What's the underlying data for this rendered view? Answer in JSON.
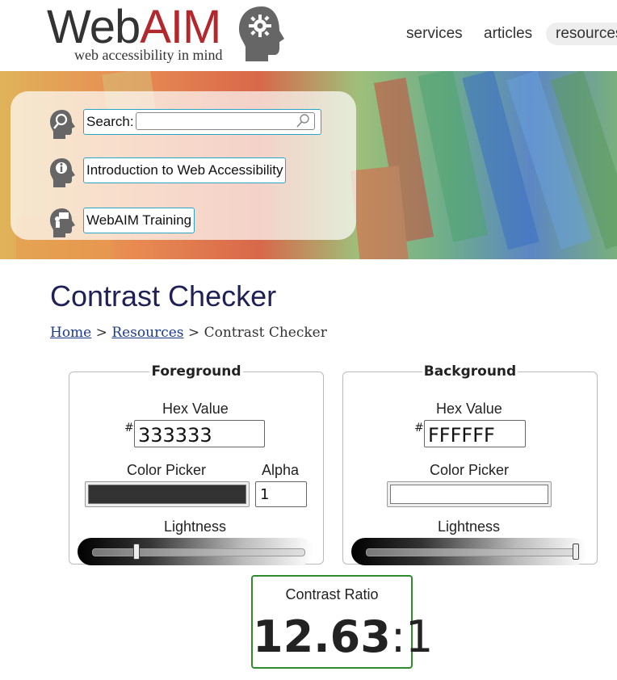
{
  "header": {
    "logo": {
      "word_web": "Web",
      "word_aim": "AIM",
      "tagline": "web accessibility in mind"
    },
    "nav": [
      {
        "label": "services"
      },
      {
        "label": "articles"
      },
      {
        "label": "resources"
      }
    ]
  },
  "quicklinks": {
    "search_label": "Search:",
    "search_value": "",
    "intro_link": "Introduction to Web Accessibility",
    "training_link": "WebAIM Training"
  },
  "page": {
    "title": "Contrast Checker",
    "breadcrumb": {
      "home": "Home",
      "resources": "Resources",
      "sep": ">",
      "current": "Contrast Checker"
    }
  },
  "foreground": {
    "legend": "Foreground",
    "hex_label": "Hex Value",
    "hash": "#",
    "hex_value": "333333",
    "picker_label": "Color Picker",
    "picker_color": "#333333",
    "alpha_label": "Alpha",
    "alpha_value": "1",
    "lightness_label": "Lightness",
    "lightness_fraction": 0.2
  },
  "background": {
    "legend": "Background",
    "hex_label": "Hex Value",
    "hash": "#",
    "hex_value": "FFFFFF",
    "picker_label": "Color Picker",
    "picker_color": "#FFFFFF",
    "lightness_label": "Lightness",
    "lightness_fraction": 1.0
  },
  "result": {
    "label": "Contrast Ratio",
    "ratio_value": "12.63",
    "ratio_sep": ":",
    "ratio_base": "1"
  },
  "colors": {
    "accent_border": "#2aa5c8",
    "pass_green": "#2e8b2e",
    "title": "#1f2055",
    "logo_red": "#b3282d"
  }
}
